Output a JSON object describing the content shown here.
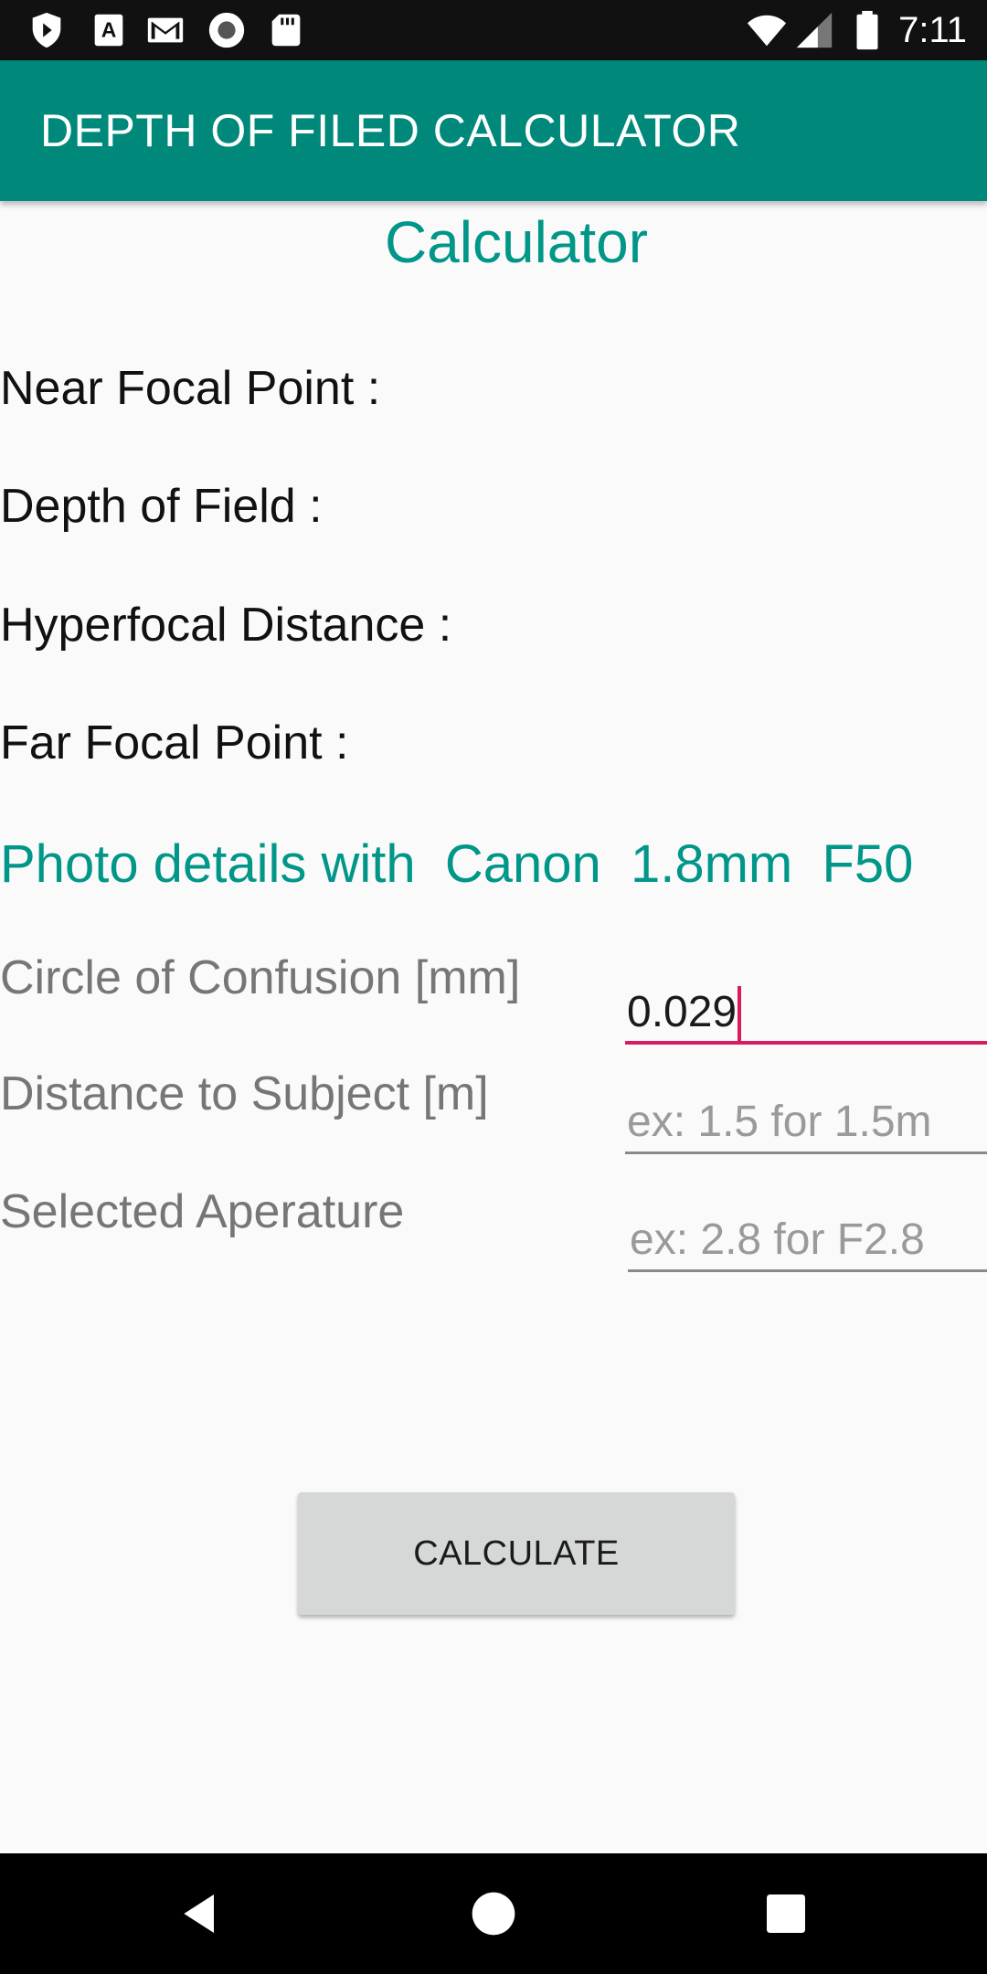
{
  "status_bar": {
    "time": "7:11",
    "left_icons": [
      "shield-icon",
      "accessibility-a-icon",
      "gmail-icon",
      "record-icon",
      "sd-card-icon"
    ],
    "right_icons": [
      "wifi-icon",
      "cell-signal-icon",
      "battery-icon"
    ]
  },
  "app_bar": {
    "title": "DEPTH OF FILED CALCULATOR",
    "color": "#00897b"
  },
  "main": {
    "section_title": "Calculator",
    "results": [
      {
        "label": "Near Focal Point :"
      },
      {
        "label": "Depth of Field :"
      },
      {
        "label": "Hyperfocal Distance :"
      },
      {
        "label": "Far Focal Point :"
      }
    ],
    "photo_details": "Photo details with  Canon  1.8mm  F50",
    "inputs": [
      {
        "label": "Circle of Confusion [mm]",
        "value": "0.029",
        "placeholder": "",
        "focused": true
      },
      {
        "label": "Distance to Subject [m]",
        "value": "",
        "placeholder": "ex: 1.5 for 1.5m",
        "focused": false
      },
      {
        "label": "Selected Aperature",
        "value": "",
        "placeholder": "ex: 2.8 for F2.8",
        "focused": false
      }
    ],
    "calculate_button": "CALCULATE"
  },
  "nav_bar": {
    "buttons": [
      "back-icon",
      "home-icon",
      "recents-icon"
    ]
  },
  "colors": {
    "accent": "#009688",
    "focus_underline": "#d81b60",
    "button": "#d6d7d7"
  }
}
